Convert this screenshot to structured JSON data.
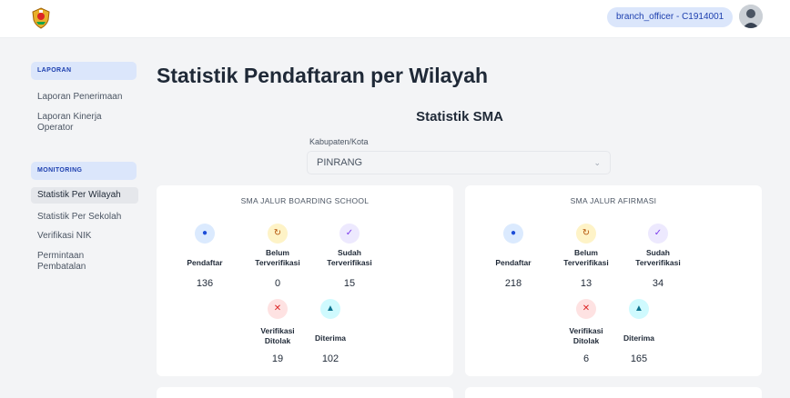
{
  "header": {
    "user_label": "branch_officer - C1914001"
  },
  "sidebar": {
    "laporan_section": "LAPORAN",
    "laporan_items": [
      "Laporan Penerimaan",
      "Laporan Kinerja Operator"
    ],
    "monitoring_section": "MONITORING",
    "monitoring_items": [
      "Statistik Per Wilayah",
      "Statistik Per Sekolah",
      "Verifikasi NIK",
      "Permintaan Pembatalan"
    ],
    "active_item": "Statistik Per Wilayah"
  },
  "main": {
    "title": "Statistik Pendaftaran per Wilayah",
    "subtitle": "Statistik SMA",
    "filter": {
      "label": "Kabupaten/Kota",
      "value": "PINRANG"
    },
    "cards": [
      {
        "title": "SMA JALUR BOARDING SCHOOL",
        "stats": {
          "pendaftar": {
            "label": "Pendaftar",
            "value": "136",
            "icon": "user-icon"
          },
          "belum": {
            "label_1": "Belum",
            "label_2": "Terverifikasi",
            "value": "0",
            "icon": "refresh-icon"
          },
          "sudah": {
            "label_1": "Sudah",
            "label_2": "Terverifikasi",
            "value": "15",
            "icon": "check-icon"
          },
          "ditolak": {
            "label_1": "Verifikasi",
            "label_2": "Ditolak",
            "value": "19",
            "icon": "close-icon"
          },
          "diterima": {
            "label": "Diterima",
            "value": "102",
            "icon": "graduation-cap-icon"
          }
        }
      },
      {
        "title": "SMA JALUR AFIRMASI",
        "stats": {
          "pendaftar": {
            "label": "Pendaftar",
            "value": "218",
            "icon": "user-icon"
          },
          "belum": {
            "label_1": "Belum",
            "label_2": "Terverifikasi",
            "value": "13",
            "icon": "refresh-icon"
          },
          "sudah": {
            "label_1": "Sudah",
            "label_2": "Terverifikasi",
            "value": "34",
            "icon": "check-icon"
          },
          "ditolak": {
            "label_1": "Verifikasi",
            "label_2": "Ditolak",
            "value": "6",
            "icon": "close-icon"
          },
          "diterima": {
            "label": "Diterima",
            "value": "165",
            "icon": "graduation-cap-icon"
          }
        }
      }
    ]
  },
  "colors": {
    "accent": "#1e40af",
    "accent_bg": "#dbe6fb",
    "page_bg": "#f3f4f6"
  }
}
